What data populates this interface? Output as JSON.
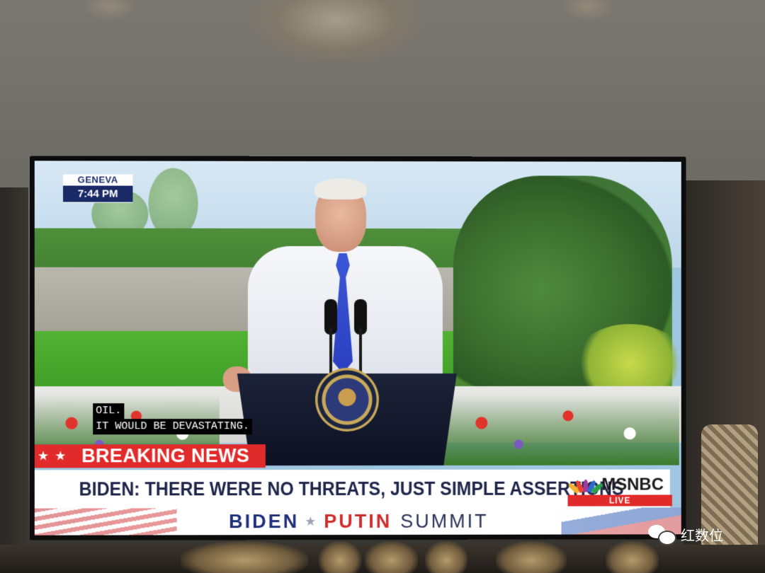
{
  "broadcast": {
    "location": "GENEVA",
    "time": "7:44 PM",
    "captions": [
      "OIL.",
      "IT WOULD BE DEVASTATING."
    ],
    "breaking_label": "BREAKING NEWS",
    "headline": "BIDEN: THERE WERE NO THREATS, JUST SIMPLE ASSERTIONS",
    "network": "MSNBC",
    "live_label": "LIVE",
    "summit": {
      "left": "BIDEN",
      "separator": "★",
      "right": "PUTIN",
      "suffix": "SUMMIT"
    }
  },
  "watermark": {
    "text": "红数位",
    "icon": "wechat-icon"
  },
  "colors": {
    "breaking_red": "#e12b2b",
    "navy": "#1a2a66",
    "putin_red": "#d02c2c",
    "tie_blue": "#2a3fbf"
  }
}
